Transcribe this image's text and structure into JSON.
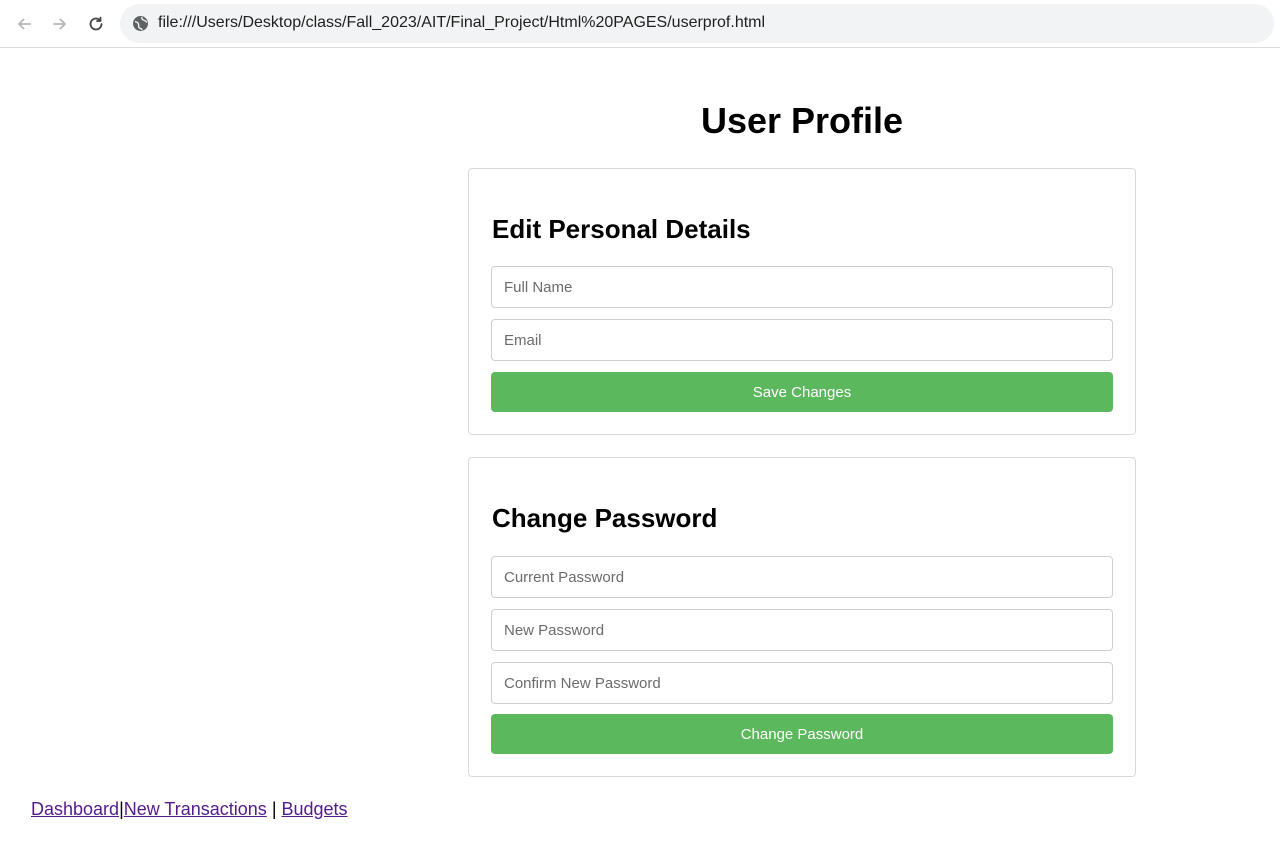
{
  "browser": {
    "url": "file:///Users/Desktop/class/Fall_2023/AIT/Final_Project/Html%20PAGES/userprof.html"
  },
  "page": {
    "title": "User Profile"
  },
  "personal_details": {
    "heading": "Edit Personal Details",
    "full_name_placeholder": "Full Name",
    "email_placeholder": "Email",
    "save_label": "Save Changes"
  },
  "change_password": {
    "heading": "Change Password",
    "current_placeholder": "Current Password",
    "new_placeholder": "New Password",
    "confirm_placeholder": "Confirm New Password",
    "submit_label": "Change Password"
  },
  "footer": {
    "links": [
      "Dashboard",
      "New Transactions",
      "Budgets"
    ],
    "separators": [
      "|",
      " | "
    ]
  },
  "colors": {
    "button_green": "#5cb85c",
    "visited_link": "#551a8b"
  }
}
